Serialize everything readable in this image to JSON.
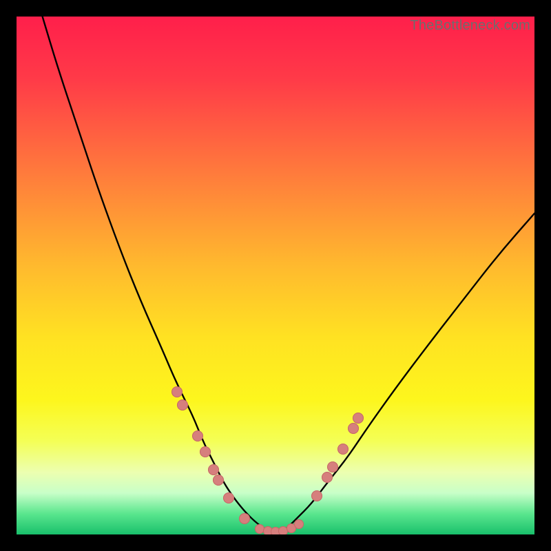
{
  "watermark": "TheBottleneck.com",
  "colors": {
    "frame": "#000000",
    "gradient_stops": [
      {
        "offset": 0.0,
        "color": "#ff1f4b"
      },
      {
        "offset": 0.12,
        "color": "#ff3a48"
      },
      {
        "offset": 0.3,
        "color": "#ff7a3c"
      },
      {
        "offset": 0.48,
        "color": "#ffb92e"
      },
      {
        "offset": 0.62,
        "color": "#ffe222"
      },
      {
        "offset": 0.74,
        "color": "#fdf61d"
      },
      {
        "offset": 0.82,
        "color": "#f4ff56"
      },
      {
        "offset": 0.88,
        "color": "#ecffb0"
      },
      {
        "offset": 0.92,
        "color": "#c8ffc8"
      },
      {
        "offset": 0.96,
        "color": "#5ae68e"
      },
      {
        "offset": 1.0,
        "color": "#19c06b"
      }
    ],
    "curve": "#000000",
    "dot_fill": "#d67f7d",
    "dot_stroke": "#c56866"
  },
  "chart_data": {
    "type": "line",
    "title": "",
    "xlabel": "",
    "ylabel": "",
    "xlim": [
      0,
      100
    ],
    "ylim": [
      0,
      100
    ],
    "grid": false,
    "legend": false,
    "annotations": [
      {
        "text": "TheBottleneck.com",
        "position": "top-right"
      }
    ],
    "series": [
      {
        "name": "left-curve",
        "x": [
          5,
          8,
          12,
          16,
          20,
          24,
          28,
          31,
          34,
          36,
          38,
          40,
          42,
          44,
          46,
          48,
          50
        ],
        "y": [
          100,
          90,
          78,
          66,
          55,
          45,
          36,
          29,
          23,
          18,
          14,
          10,
          7,
          4.5,
          2.5,
          1,
          0
        ]
      },
      {
        "name": "right-curve",
        "x": [
          50,
          52,
          54,
          57,
          60,
          64,
          68,
          73,
          79,
          86,
          93,
          100
        ],
        "y": [
          0,
          1,
          3,
          6,
          10,
          15,
          21,
          28,
          36,
          45,
          54,
          62
        ]
      }
    ],
    "markers": {
      "name": "highlight-dots",
      "fill": "#d67f7d",
      "radius_px": 8,
      "points": [
        {
          "x": 31.0,
          "y": 27.5
        },
        {
          "x": 32.0,
          "y": 25.0
        },
        {
          "x": 35.0,
          "y": 19.0
        },
        {
          "x": 36.5,
          "y": 16.0
        },
        {
          "x": 38.0,
          "y": 12.5
        },
        {
          "x": 39.0,
          "y": 10.5
        },
        {
          "x": 41.0,
          "y": 7.0
        },
        {
          "x": 44.0,
          "y": 3.0
        },
        {
          "x": 47.0,
          "y": 1.0,
          "r": 7
        },
        {
          "x": 48.5,
          "y": 0.7,
          "r": 7
        },
        {
          "x": 50.0,
          "y": 0.5,
          "r": 7
        },
        {
          "x": 51.5,
          "y": 0.7,
          "r": 7
        },
        {
          "x": 53.0,
          "y": 1.2,
          "r": 7
        },
        {
          "x": 54.5,
          "y": 2.0,
          "r": 7
        },
        {
          "x": 58.0,
          "y": 7.5
        },
        {
          "x": 60.0,
          "y": 11.0
        },
        {
          "x": 61.0,
          "y": 13.0
        },
        {
          "x": 63.0,
          "y": 16.5
        },
        {
          "x": 65.0,
          "y": 20.5
        },
        {
          "x": 66.0,
          "y": 22.5
        }
      ]
    }
  }
}
